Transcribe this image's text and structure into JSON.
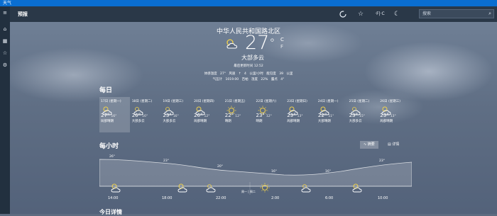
{
  "app": {
    "title": "天气",
    "section": "预报"
  },
  "colors": {
    "titlebar": "#0a6ed1",
    "toolbar": "#2a3848",
    "sidebar": "#22303f",
    "sun": "#f2d24b"
  },
  "toolbar": {
    "refresh_icon": "refresh-icon",
    "favorite_icon": "star-icon",
    "unit_toggle": "·F|·C",
    "moon_icon": "moon-icon",
    "search_placeholder": "搜索",
    "search_icon": "search-icon"
  },
  "sidebar": [
    {
      "icon": "home-icon",
      "glyph": "⌂"
    },
    {
      "icon": "map-icon",
      "glyph": "▦"
    },
    {
      "icon": "star-icon",
      "glyph": "☆"
    },
    {
      "icon": "settings-icon",
      "glyph": "⚙"
    }
  ],
  "current": {
    "location": "中华人民共和国路北区",
    "temperature": "27",
    "degree": "°",
    "unit_c": "C",
    "unit_f": "F",
    "condition": "大部多云",
    "updated": "最后更新时间 12:52",
    "details_line1": "体感温度 27°   风速 ↑ 4 公里/小时   能见度 39 公里",
    "details_line2": "气压计 1019.00 百帕   湿度 22%   露点 4°"
  },
  "daily": {
    "heading": "每日",
    "days": [
      {
        "date": "17日 (星期一)",
        "high": "27°",
        "low": "16°",
        "cond": "局部晴朗",
        "icon": "partly-sunny"
      },
      {
        "date": "18日 (星期二)",
        "high": "26°",
        "low": "16°",
        "cond": "大部多云",
        "icon": "cloudy"
      },
      {
        "date": "19日 (星期三)",
        "high": "23°",
        "low": "16°",
        "cond": "大部多云",
        "icon": "cloudy"
      },
      {
        "date": "20日 (星期四)",
        "high": "26°",
        "low": "12°",
        "cond": "局部晴朗",
        "icon": "partly-sunny"
      },
      {
        "date": "21日 (星期五)",
        "high": "22°",
        "low": "12°",
        "cond": "晴朗",
        "icon": "sunny"
      },
      {
        "date": "22日 (星期六)",
        "high": "23°",
        "low": "12°",
        "cond": "晴朗",
        "icon": "sunny"
      },
      {
        "date": "23日 (星期日)",
        "high": "23°",
        "low": "13°",
        "cond": "局部晴朗",
        "icon": "partly-sunny"
      },
      {
        "date": "24日 (星期一)",
        "high": "22°",
        "low": "11°",
        "cond": "大部晴朗",
        "icon": "partly-sunny"
      },
      {
        "date": "25日 (星期二)",
        "high": "23°",
        "low": "15°",
        "cond": "大部多云",
        "icon": "cloudy"
      },
      {
        "date": "26日 (星期三)",
        "high": "23°",
        "low": "13°",
        "cond": "局部晴朗",
        "icon": "partly-sunny"
      }
    ]
  },
  "hourly": {
    "heading": "每小时",
    "summary_label": "摘要",
    "detail_label": "详情",
    "hours": [
      "14:00",
      "18:00",
      "22:00",
      "2:00",
      "6:00",
      "10:00"
    ],
    "temps": [
      "26°",
      "23°",
      "20°",
      "16°",
      "16°",
      "23°"
    ],
    "divider_label": "周一 | 周二"
  },
  "today_details_heading": "今日详情"
}
